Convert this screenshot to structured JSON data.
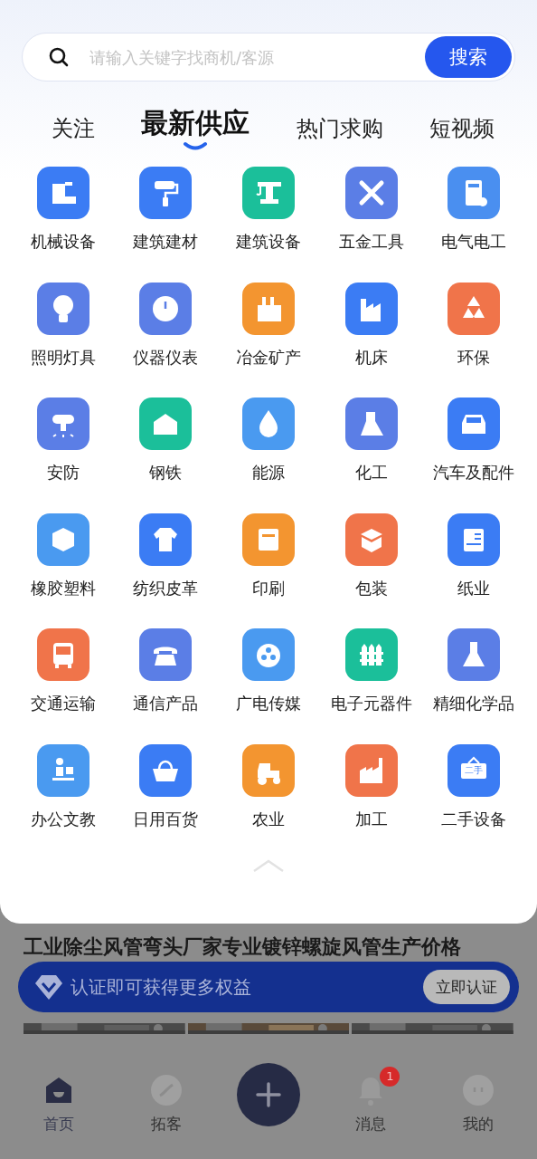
{
  "search": {
    "placeholder": "请输入关键字找商机/客源",
    "button": "搜索"
  },
  "tabs": [
    {
      "label": "关注",
      "selected": false
    },
    {
      "label": "最新供应",
      "selected": true
    },
    {
      "label": "热门求购",
      "selected": false
    },
    {
      "label": "短视频",
      "selected": false
    }
  ],
  "categories": [
    {
      "label": "机械设备",
      "color": "#3b7cf4"
    },
    {
      "label": "建筑建材",
      "color": "#3b7cf4"
    },
    {
      "label": "建筑设备",
      "color": "#1bbf9a"
    },
    {
      "label": "五金工具",
      "color": "#5b7ee6"
    },
    {
      "label": "电气电工",
      "color": "#4a8ff0"
    },
    {
      "label": "照明灯具",
      "color": "#5b7ee6"
    },
    {
      "label": "仪器仪表",
      "color": "#5b7ee6"
    },
    {
      "label": "冶金矿产",
      "color": "#f39530"
    },
    {
      "label": "机床",
      "color": "#3b7cf4"
    },
    {
      "label": "环保",
      "color": "#f0744a"
    },
    {
      "label": "安防",
      "color": "#5b7ee6"
    },
    {
      "label": "钢铁",
      "color": "#1bbf9a"
    },
    {
      "label": "能源",
      "color": "#4a9af0"
    },
    {
      "label": "化工",
      "color": "#5b7ee6"
    },
    {
      "label": "汽车及配件",
      "color": "#3b7cf4"
    },
    {
      "label": "橡胶塑料",
      "color": "#4a9af0"
    },
    {
      "label": "纺织皮革",
      "color": "#3b7cf4"
    },
    {
      "label": "印刷",
      "color": "#f39530"
    },
    {
      "label": "包装",
      "color": "#f0744a"
    },
    {
      "label": "纸业",
      "color": "#3b7cf4"
    },
    {
      "label": "交通运输",
      "color": "#f0744a"
    },
    {
      "label": "通信产品",
      "color": "#5b7ee6"
    },
    {
      "label": "广电传媒",
      "color": "#4a9af0"
    },
    {
      "label": "电子元器件",
      "color": "#1bbf9a"
    },
    {
      "label": "精细化学品",
      "color": "#5b7ee6"
    },
    {
      "label": "办公文教",
      "color": "#4a9af0"
    },
    {
      "label": "日用百货",
      "color": "#3b7cf4"
    },
    {
      "label": "农业",
      "color": "#f39530"
    },
    {
      "label": "加工",
      "color": "#f0744a"
    },
    {
      "label": "二手设备",
      "color": "#3b7cf4"
    }
  ],
  "last_category_sign": {
    "text": "二手"
  },
  "feed": {
    "title": "工业除尘风管弯头厂家专业镀锌螺旋风管生产价格"
  },
  "banner": {
    "text": "认证即可获得更多权益",
    "button": "立即认证"
  },
  "bottom_nav": [
    {
      "label": "首页",
      "selected": true,
      "kind": "tab"
    },
    {
      "label": "拓客",
      "selected": false,
      "kind": "tab"
    },
    {
      "kind": "add"
    },
    {
      "label": "消息",
      "selected": false,
      "kind": "tab",
      "badge": "1"
    },
    {
      "label": "我的",
      "selected": false,
      "kind": "tab"
    }
  ]
}
